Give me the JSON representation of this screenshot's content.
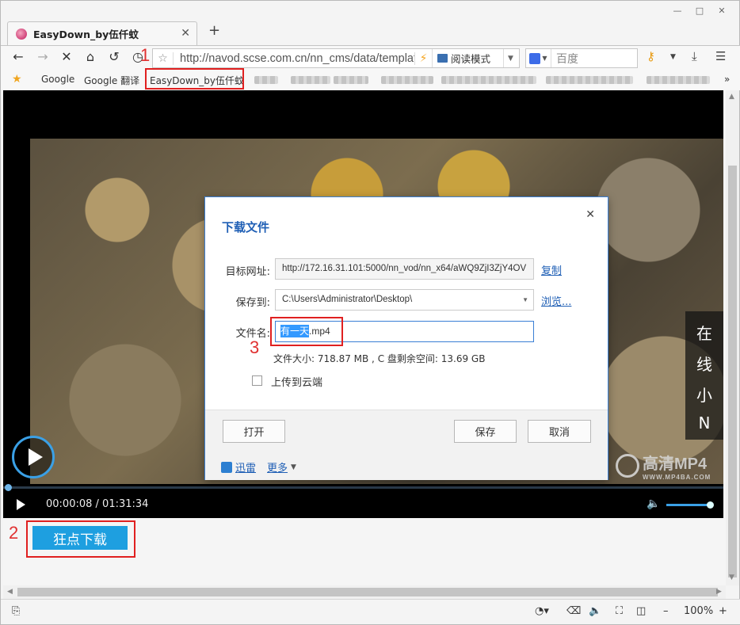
{
  "browser": {
    "tab_title": "EasyDown_by伍仟蚊",
    "new_tab": "+",
    "url": "http://navod.scse.com.cn/nn_cms/data/template",
    "reader_mode": "阅读模式",
    "search_placeholder": "百度"
  },
  "bookmarks": {
    "items": [
      "Google",
      "Google 翻译",
      "EasyDown_by伍仟蚊"
    ],
    "more": "»"
  },
  "annotations": {
    "n1": "1",
    "n2": "2",
    "n3": "3"
  },
  "player": {
    "current_time": "00:00:08",
    "separator": " / ",
    "duration": "01:31:34",
    "side_text": [
      "在",
      "线",
      "小",
      "N"
    ],
    "watermark": "高清MP4",
    "watermark_sub": "WWW.MP4BA.COM",
    "progress": 0.0015,
    "volume": 1.0
  },
  "download_button": "狂点下载",
  "dialog": {
    "title": "下载文件",
    "target_label": "目标网址:",
    "target_value": "http://172.16.31.101:5000/nn_vod/nn_x64/aWQ9ZjI3ZjY4OV",
    "copy_link": "复制",
    "save_to_label": "保存到:",
    "save_to_value": "C:\\Users\\Administrator\\Desktop\\",
    "browse_link": "浏览...",
    "filename_label": "文件名:",
    "filename_base": "有一天",
    "filename_ext": ".mp4",
    "file_info": "文件大小: 718.87 MB , C 盘剩余空间: 13.69 GB",
    "upload_label": "上传到云端",
    "open_button": "打开",
    "save_button": "保存",
    "cancel_button": "取消",
    "xunlei_link": "迅雷",
    "more_link": "更多"
  },
  "statusbar": {
    "zoom": "100%"
  }
}
